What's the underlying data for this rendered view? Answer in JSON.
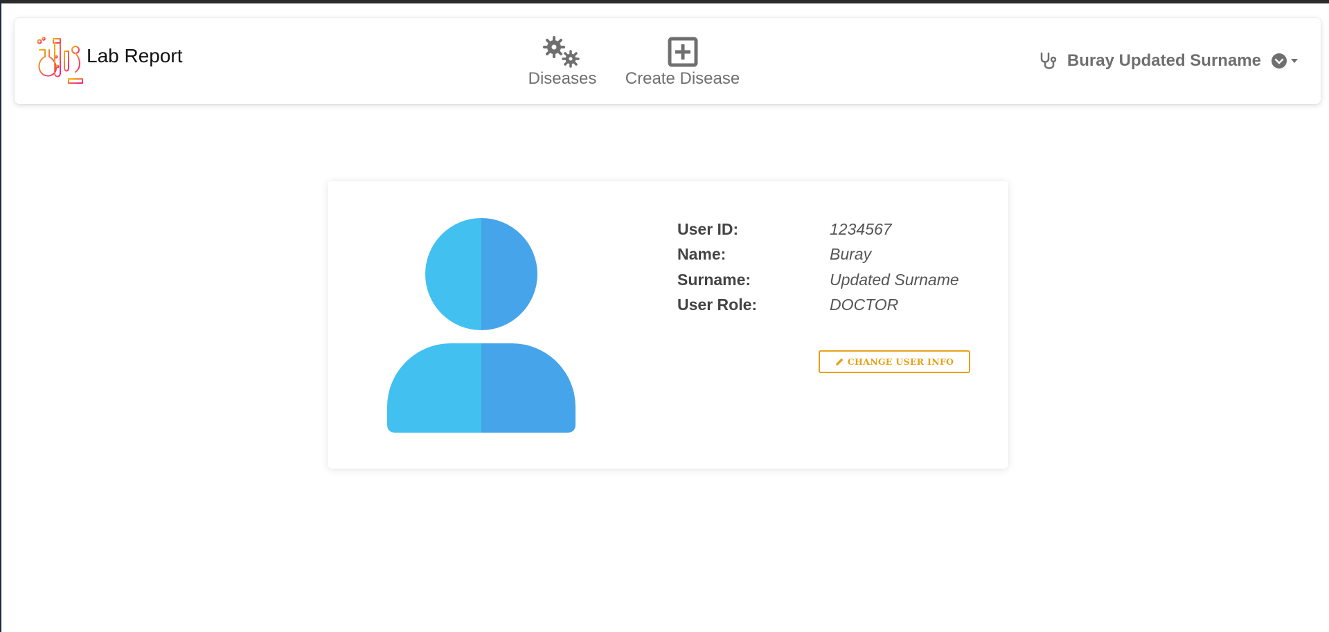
{
  "brand": {
    "title": "Lab Report",
    "logo_icon": "lab-flasks-microscope-icon"
  },
  "nav": {
    "items": [
      {
        "label": "Diseases",
        "icon": "viruses-gears-icon"
      },
      {
        "label": "Create Disease",
        "icon": "plus-square-icon"
      }
    ]
  },
  "user_menu": {
    "name": "Buray Updated Surname",
    "icon": "stethoscope-icon",
    "toggle_icon": "chevron-circle-down-icon"
  },
  "profile": {
    "fields": [
      {
        "label": "User ID:",
        "value": "1234567"
      },
      {
        "label": "Name:",
        "value": "Buray"
      },
      {
        "label": "Surname:",
        "value": "Updated Surname"
      },
      {
        "label": "User Role:",
        "value": "DOCTOR"
      }
    ],
    "change_button_label": "CHANGE USER INFO",
    "avatar_icon": "user-avatar-icon"
  },
  "colors": {
    "accent": "#e6a117",
    "avatar_light": "#42c0f0",
    "avatar_dark": "#46a4ea",
    "nav_text": "#6f6f6f"
  }
}
